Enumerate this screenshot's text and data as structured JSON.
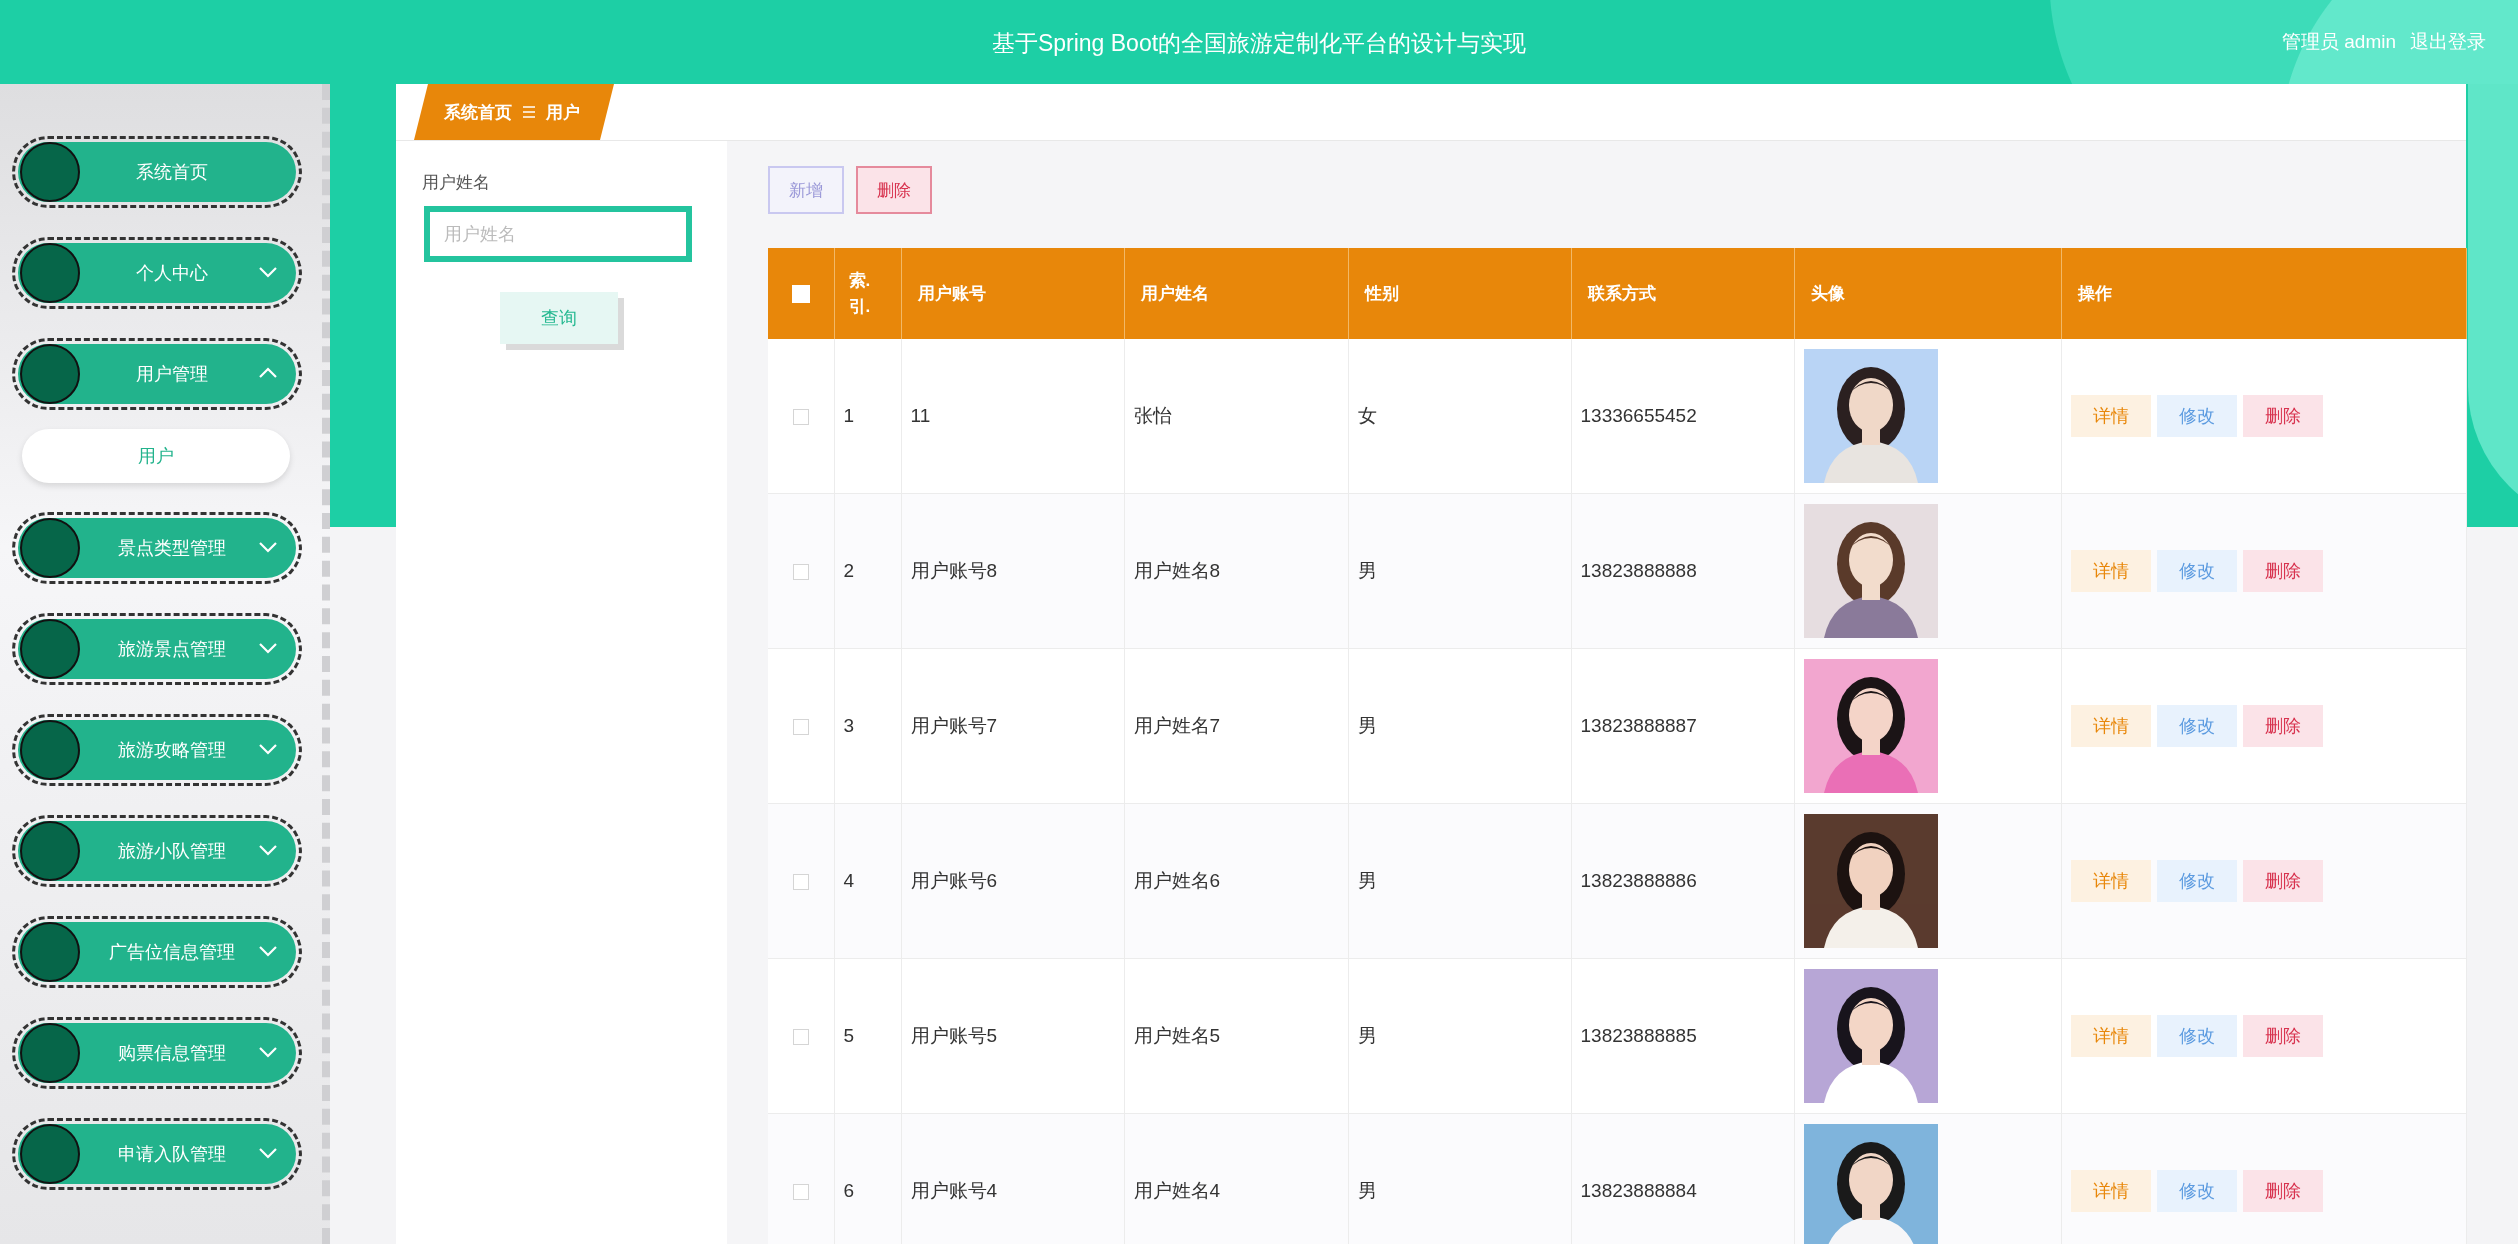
{
  "header": {
    "title": "基于Spring Boot的全国旅游定制化平台的设计与实现",
    "user_label": "管理员 admin",
    "logout": "退出登录"
  },
  "sidebar": {
    "items": [
      {
        "label": "系统首页",
        "kind": "link"
      },
      {
        "label": "个人中心",
        "kind": "menu",
        "expanded": false
      },
      {
        "label": "用户管理",
        "kind": "menu",
        "expanded": true,
        "children": [
          {
            "label": "用户",
            "selected": true
          }
        ]
      },
      {
        "label": "景点类型管理",
        "kind": "menu",
        "expanded": false
      },
      {
        "label": "旅游景点管理",
        "kind": "menu",
        "expanded": false
      },
      {
        "label": "旅游攻略管理",
        "kind": "menu",
        "expanded": false
      },
      {
        "label": "旅游小队管理",
        "kind": "menu",
        "expanded": false
      },
      {
        "label": "广告位信息管理",
        "kind": "menu",
        "expanded": false
      },
      {
        "label": "购票信息管理",
        "kind": "menu",
        "expanded": false
      },
      {
        "label": "申请入队管理",
        "kind": "menu",
        "expanded": false
      }
    ]
  },
  "breadcrumb": {
    "items": [
      "系统首页",
      "用户"
    ]
  },
  "search": {
    "label": "用户姓名",
    "placeholder": "用户姓名",
    "button": "查询"
  },
  "toolbar": {
    "buttons": [
      {
        "label": "新增",
        "kind": "add"
      },
      {
        "label": "删除",
        "kind": "delete"
      }
    ]
  },
  "table": {
    "select_all_checked": false,
    "columns": [
      "索.引.",
      "用户账号",
      "用户姓名",
      "性别",
      "联系方式",
      "头像",
      "操作"
    ],
    "rows": [
      {
        "checked": false,
        "index": "1",
        "account": "11",
        "name": "张怡",
        "gender": "女",
        "phone": "13336655452",
        "actions": [
          {
            "label": "详情",
            "kind": "detail"
          },
          {
            "label": "修改",
            "kind": "edit"
          },
          {
            "label": "删除",
            "kind": "delete"
          }
        ]
      },
      {
        "checked": false,
        "index": "2",
        "account": "用户账号8",
        "name": "用户姓名8",
        "gender": "男",
        "phone": "13823888888",
        "actions": [
          {
            "label": "详情",
            "kind": "detail"
          },
          {
            "label": "修改",
            "kind": "edit"
          },
          {
            "label": "删除",
            "kind": "delete"
          }
        ]
      },
      {
        "checked": false,
        "index": "3",
        "account": "用户账号7",
        "name": "用户姓名7",
        "gender": "男",
        "phone": "13823888887",
        "actions": [
          {
            "label": "详情",
            "kind": "detail"
          },
          {
            "label": "修改",
            "kind": "edit"
          },
          {
            "label": "删除",
            "kind": "delete"
          }
        ]
      },
      {
        "checked": false,
        "index": "4",
        "account": "用户账号6",
        "name": "用户姓名6",
        "gender": "男",
        "phone": "13823888886",
        "actions": [
          {
            "label": "详情",
            "kind": "detail"
          },
          {
            "label": "修改",
            "kind": "edit"
          },
          {
            "label": "删除",
            "kind": "delete"
          }
        ]
      },
      {
        "checked": false,
        "index": "5",
        "account": "用户账号5",
        "name": "用户姓名5",
        "gender": "男",
        "phone": "13823888885",
        "actions": [
          {
            "label": "详情",
            "kind": "detail"
          },
          {
            "label": "修改",
            "kind": "edit"
          },
          {
            "label": "删除",
            "kind": "delete"
          }
        ]
      },
      {
        "checked": false,
        "index": "6",
        "account": "用户账号4",
        "name": "用户姓名4",
        "gender": "男",
        "phone": "13823888884",
        "actions": [
          {
            "label": "详情",
            "kind": "detail"
          },
          {
            "label": "修改",
            "kind": "edit"
          },
          {
            "label": "删除",
            "kind": "delete"
          }
        ]
      }
    ]
  }
}
